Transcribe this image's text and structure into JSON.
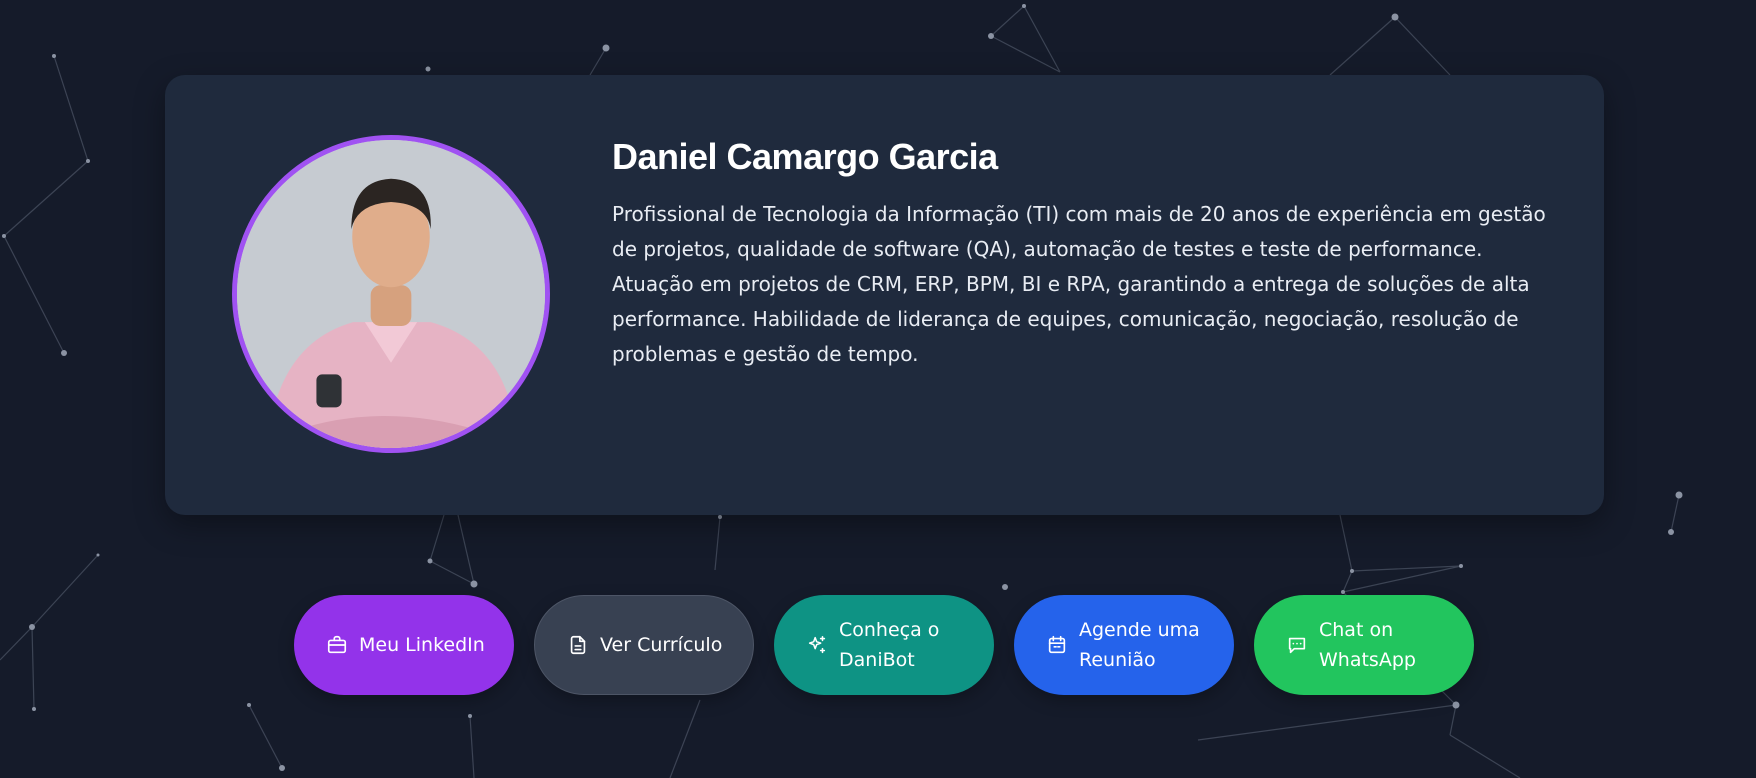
{
  "profile": {
    "name": "Daniel Camargo Garcia",
    "bio": "Profissional de Tecnologia da Informação (TI) com mais de 20 anos de experiência em gestão de projetos, qualidade de software (QA), automação de testes e teste de performance. Atuação em projetos de CRM, ERP, BPM, BI e RPA, garantindo a entrega de soluções de alta performance. Habilidade de liderança de equipes, comunicação, negociação, resolução de problemas e gestão de tempo."
  },
  "actions": [
    {
      "label": "Meu LinkedIn",
      "icon": "briefcase-icon",
      "color": "#9333ea"
    },
    {
      "label": "Ver Currículo",
      "icon": "document-icon",
      "color": "#384152"
    },
    {
      "label": "Conheça o DaniBot",
      "icon": "sparkles-icon",
      "color": "#0e9384"
    },
    {
      "label": "Agende uma Reunião",
      "icon": "calendar-icon",
      "color": "#2563eb"
    },
    {
      "label": "Chat on WhatsApp",
      "icon": "chat-bubble-icon",
      "color": "#22c55e"
    }
  ],
  "theme": {
    "background": "#151b2a",
    "card": "#1f2a3d",
    "avatar_ring": "#a052f2"
  }
}
